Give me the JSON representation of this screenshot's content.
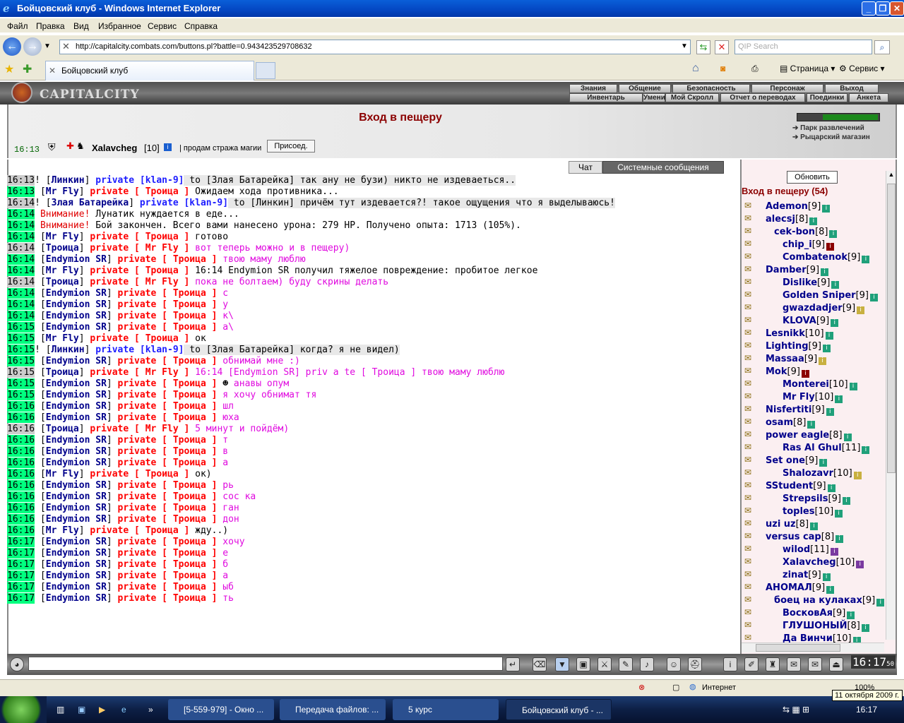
{
  "window": {
    "title": "Бойцовский клуб - Windows Internet Explorer"
  },
  "menu": [
    "Файл",
    "Правка",
    "Вид",
    "Избранное",
    "Сервис",
    "Справка"
  ],
  "address": {
    "url": "http://capitalcity.combats.com/buttons.pl?battle=0.943423529708632",
    "search_placeholder": "QIP Search"
  },
  "tab": {
    "title": "Бойцовский клуб"
  },
  "ie_toolbar": {
    "page": "Страница",
    "tools": "Сервис"
  },
  "game": {
    "logo": "CAPITALCITY",
    "top_menu": [
      "Знания",
      "Общение",
      "Безопасность",
      "Персонаж",
      "Выход"
    ],
    "sub_menu": [
      "Инвентарь",
      "Умения",
      "Мой Скролл",
      "Отчет о переводах",
      "Поединки",
      "Анкета"
    ],
    "header": {
      "title": "Вход в пещеру",
      "time": "16:13",
      "user": "Xalavcheg",
      "level": "[10]",
      "message": "| продам стража магии",
      "button": "Присоед.",
      "links": [
        "Парк развлечений",
        "Рыцарский магазин"
      ]
    },
    "chat_tabs": [
      "Чат",
      "Системные сообщения"
    ],
    "chat": [
      {
        "time": "16:13",
        "hl": true,
        "from": "Линкин",
        "kind": "private",
        "to": "[klan-9]",
        "pre": "!",
        "body": "to [Злая Батарейка] так ану не бузи) никто не издеваеться..",
        "color": "sys"
      },
      {
        "time": "16:13",
        "hl": false,
        "from": "Mr Fly",
        "kind": "private",
        "to": "[ Троица ]",
        "pre": "",
        "body": "Ожидаем хода противника...",
        "color": "n"
      },
      {
        "time": "16:14",
        "hl": true,
        "from": "Злая Батарейка",
        "kind": "private",
        "to": "[klan-9]",
        "pre": "!",
        "body": "to [Линкин] причём тут издевается?! такое ощущения что я выделываюсь!",
        "color": "sys"
      },
      {
        "time": "16:14",
        "hl": false,
        "warn": "Внимание!",
        "body": "Лунатик нуждается в еде...",
        "color": "n"
      },
      {
        "time": "16:14",
        "hl": false,
        "warn": "Внимание!",
        "body": "Бой закончен. Всего вами нанесено урона: 279 HP. Получено опыта: 1713 (105%).",
        "color": "n"
      },
      {
        "time": "16:14",
        "hl": false,
        "from": "Mr Fly",
        "kind": "private",
        "to": "[ Троица ]",
        "body": "готово",
        "color": "n"
      },
      {
        "time": "16:14",
        "hl": true,
        "from": "Троица",
        "kind": "private",
        "to": "[ Mr Fly ]",
        "body": "вот теперь можно и в пещеру)",
        "color": "m"
      },
      {
        "time": "16:14",
        "hl": false,
        "from": "Endymion SR",
        "kind": "private",
        "to": "[ Троица ]",
        "body": "твою маму люблю",
        "color": "m"
      },
      {
        "time": "16:14",
        "hl": false,
        "from": "Mr Fly",
        "kind": "private",
        "to": "[ Троица ]",
        "body": "16:14 Endymion SR получил тяжелое повреждение: пробитое легкое",
        "color": "n"
      },
      {
        "time": "16:14",
        "hl": true,
        "from": "Троица",
        "kind": "private",
        "to": "[ Mr Fly ]",
        "body": "пока не болтаем) буду скрины делать",
        "color": "m"
      },
      {
        "time": "16:14",
        "hl": false,
        "from": "Endymion SR",
        "kind": "private",
        "to": "[ Троица ]",
        "body": "с",
        "color": "m"
      },
      {
        "time": "16:14",
        "hl": false,
        "from": "Endymion SR",
        "kind": "private",
        "to": "[ Троица ]",
        "body": "у",
        "color": "m"
      },
      {
        "time": "16:14",
        "hl": false,
        "from": "Endymion SR",
        "kind": "private",
        "to": "[ Троица ]",
        "body": "к\\",
        "color": "m"
      },
      {
        "time": "16:15",
        "hl": false,
        "from": "Endymion SR",
        "kind": "private",
        "to": "[ Троица ]",
        "body": "а\\",
        "color": "m"
      },
      {
        "time": "16:15",
        "hl": false,
        "from": "Mr Fly",
        "kind": "private",
        "to": "[ Троица ]",
        "body": "ок",
        "color": "n"
      },
      {
        "time": "16:15",
        "hl": false,
        "from": "Линкин",
        "kind": "private",
        "to": "[klan-9]",
        "pre": "!",
        "body": "to [Злая Батарейка] когда? я не видел)",
        "color": "sys"
      },
      {
        "time": "16:15",
        "hl": false,
        "from": "Endymion SR",
        "kind": "private",
        "to": "[ Троица ]",
        "body": "обнимай мне :)",
        "color": "m"
      },
      {
        "time": "16:15",
        "hl": true,
        "from": "Троица",
        "kind": "private",
        "to": "[ Mr Fly ]",
        "body": "16:14 [Endymion SR] priv a te [ Троица ] твою маму люблю",
        "color": "m"
      },
      {
        "time": "16:15",
        "hl": false,
        "from": "Endymion SR",
        "kind": "private",
        "to": "[ Троица ]",
        "smile": true,
        "body": "анавы опум",
        "color": "m"
      },
      {
        "time": "16:15",
        "hl": false,
        "from": "Endymion SR",
        "kind": "private",
        "to": "[ Троица ]",
        "body": "я хочу обнимат тя",
        "color": "m"
      },
      {
        "time": "16:16",
        "hl": false,
        "from": "Endymion SR",
        "kind": "private",
        "to": "[ Троица ]",
        "body": "шл",
        "color": "m"
      },
      {
        "time": "16:16",
        "hl": false,
        "from": "Endymion SR",
        "kind": "private",
        "to": "[ Троица ]",
        "body": "юха",
        "color": "m"
      },
      {
        "time": "16:16",
        "hl": true,
        "from": "Троица",
        "kind": "private",
        "to": "[ Mr Fly ]",
        "body": "5 минут и пойдём)",
        "color": "m"
      },
      {
        "time": "16:16",
        "hl": false,
        "from": "Endymion SR",
        "kind": "private",
        "to": "[ Троица ]",
        "body": "т",
        "color": "m"
      },
      {
        "time": "16:16",
        "hl": false,
        "from": "Endymion SR",
        "kind": "private",
        "to": "[ Троица ]",
        "body": "в",
        "color": "m"
      },
      {
        "time": "16:16",
        "hl": false,
        "from": "Endymion SR",
        "kind": "private",
        "to": "[ Троица ]",
        "body": "а",
        "color": "m"
      },
      {
        "time": "16:16",
        "hl": false,
        "from": "Mr Fly",
        "kind": "private",
        "to": "[ Троица ]",
        "body": "ок)",
        "color": "n"
      },
      {
        "time": "16:16",
        "hl": false,
        "from": "Endymion SR",
        "kind": "private",
        "to": "[ Троица ]",
        "body": "рь",
        "color": "m"
      },
      {
        "time": "16:16",
        "hl": false,
        "from": "Endymion SR",
        "kind": "private",
        "to": "[ Троица ]",
        "body": "сос ка",
        "color": "m"
      },
      {
        "time": "16:16",
        "hl": false,
        "from": "Endymion SR",
        "kind": "private",
        "to": "[ Троица ]",
        "body": "ган",
        "color": "m"
      },
      {
        "time": "16:16",
        "hl": false,
        "from": "Endymion SR",
        "kind": "private",
        "to": "[ Троица ]",
        "body": "дон",
        "color": "m"
      },
      {
        "time": "16:16",
        "hl": false,
        "from": "Mr Fly",
        "kind": "private",
        "to": "[ Троица ]",
        "body": "жду..)",
        "color": "n"
      },
      {
        "time": "16:17",
        "hl": false,
        "from": "Endymion SR",
        "kind": "private",
        "to": "[ Троица ]",
        "body": "хочу",
        "color": "m"
      },
      {
        "time": "16:17",
        "hl": false,
        "from": "Endymion SR",
        "kind": "private",
        "to": "[ Троица ]",
        "body": "е",
        "color": "m"
      },
      {
        "time": "16:17",
        "hl": false,
        "from": "Endymion SR",
        "kind": "private",
        "to": "[ Троица ]",
        "body": "б",
        "color": "m"
      },
      {
        "time": "16:17",
        "hl": false,
        "from": "Endymion SR",
        "kind": "private",
        "to": "[ Троица ]",
        "body": "а",
        "color": "m"
      },
      {
        "time": "16:17",
        "hl": false,
        "from": "Endymion SR",
        "kind": "private",
        "to": "[ Троица ]",
        "body": "ыб",
        "color": "m"
      },
      {
        "time": "16:17",
        "hl": false,
        "from": "Endymion SR",
        "kind": "private",
        "to": "[ Троица ]",
        "body": "ть",
        "color": "m"
      }
    ],
    "online": {
      "refresh": "Обновить",
      "location": "Вход в пещеру (54)",
      "players": [
        {
          "name": "Ademon",
          "lvl": "[9]"
        },
        {
          "name": "alecsj",
          "lvl": "[8]"
        },
        {
          "name": "cek-bon",
          "lvl": "[8]"
        },
        {
          "name": "chip_i",
          "lvl": "[9]"
        },
        {
          "name": "Combatenok",
          "lvl": "[9]"
        },
        {
          "name": "Damber",
          "lvl": "[9]"
        },
        {
          "name": "Dislike",
          "lvl": "[9]"
        },
        {
          "name": "Golden Sniper",
          "lvl": "[9]"
        },
        {
          "name": "gwazdadjer",
          "lvl": "[9]"
        },
        {
          "name": "KLOVA",
          "lvl": "[9]"
        },
        {
          "name": "Lesnikk",
          "lvl": "[10]"
        },
        {
          "name": "Lighting",
          "lvl": "[9]"
        },
        {
          "name": "Massaa",
          "lvl": "[9]"
        },
        {
          "name": "Mok",
          "lvl": "[9]"
        },
        {
          "name": "Monterei",
          "lvl": "[10]"
        },
        {
          "name": "Mr Fly",
          "lvl": "[10]"
        },
        {
          "name": "Nisfertiti",
          "lvl": "[9]"
        },
        {
          "name": "osam",
          "lvl": "[8]"
        },
        {
          "name": "power eagle",
          "lvl": "[8]"
        },
        {
          "name": "Ras Al Ghul",
          "lvl": "[11]"
        },
        {
          "name": "Set one",
          "lvl": "[9]"
        },
        {
          "name": "Shalozavr",
          "lvl": "[10]"
        },
        {
          "name": "SStudent",
          "lvl": "[9]"
        },
        {
          "name": "Strepsils",
          "lvl": "[9]"
        },
        {
          "name": "toples",
          "lvl": "[10]"
        },
        {
          "name": "uzi uz",
          "lvl": "[8]"
        },
        {
          "name": "versus cap",
          "lvl": "[8]"
        },
        {
          "name": "wilod",
          "lvl": "[11]"
        },
        {
          "name": "Xalavcheg",
          "lvl": "[10]"
        },
        {
          "name": "zinat",
          "lvl": "[9]"
        },
        {
          "name": "АНОМАЛ",
          "lvl": "[9]"
        },
        {
          "name": "боец на кулаках",
          "lvl": "[9]"
        },
        {
          "name": "ВосковАя",
          "lvl": "[9]"
        },
        {
          "name": "ГЛУШОНЫЙ",
          "lvl": "[8]"
        },
        {
          "name": "Да Винчи",
          "lvl": "[10]"
        }
      ]
    },
    "clock": "16:17",
    "clock_sec": "50"
  },
  "statusbar": {
    "zone": "Интернет",
    "zoom": "100%"
  },
  "taskbar": {
    "tasks": [
      "[5-559-979] - Окно ...",
      "Передача файлов: ...",
      "5 курс",
      "Бойцовский клуб - ..."
    ],
    "time": "16:17",
    "date_tooltip": "11 октября 2009 г."
  }
}
